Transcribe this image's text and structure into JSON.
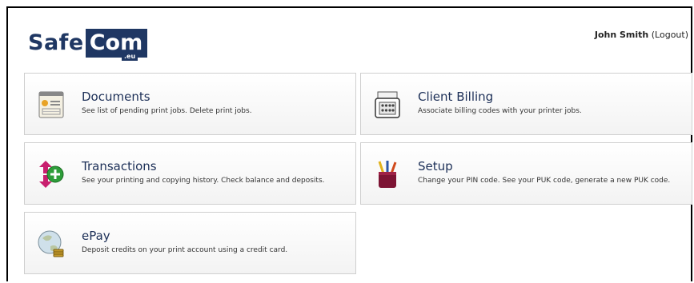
{
  "brand": {
    "safe": "Safe",
    "com": "Com",
    "eu": ".eu"
  },
  "user": {
    "name": "John Smith",
    "logout": "(Logout)"
  },
  "tiles": [
    {
      "title": "Documents",
      "desc": "See list of pending print jobs. Delete print jobs.",
      "icon": "documents-icon"
    },
    {
      "title": "Client Billing",
      "desc": "Associate billing codes with your printer jobs.",
      "icon": "calculator-icon"
    },
    {
      "title": "Transactions",
      "desc": "See your printing and copying history. Check balance and deposits.",
      "icon": "transactions-icon"
    },
    {
      "title": "Setup",
      "desc": "Change your PIN code. See your PUK code, generate a new PUK code.",
      "icon": "pencil-cup-icon"
    },
    {
      "title": "ePay",
      "desc": "Deposit credits on your print account using a credit card.",
      "icon": "globe-coins-icon"
    }
  ],
  "colors": {
    "brand": "#1f3763",
    "tile_border": "#cfcfcf"
  }
}
